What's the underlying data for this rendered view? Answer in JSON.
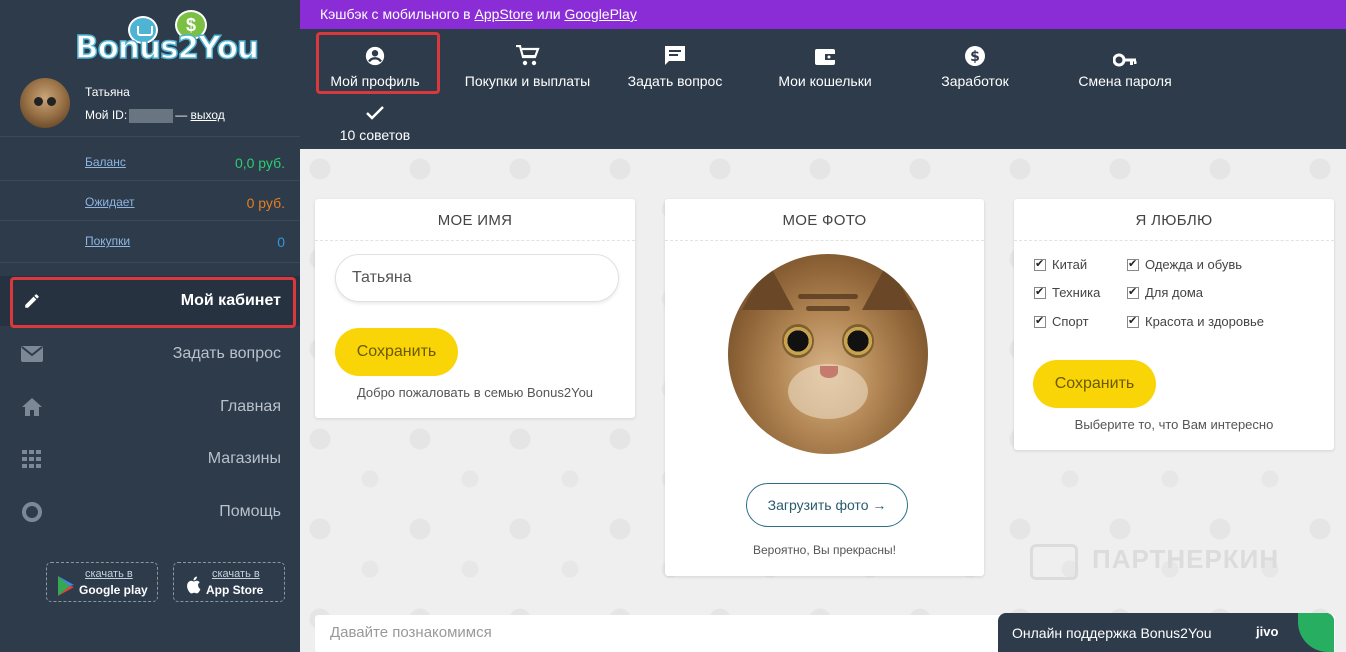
{
  "sidebar": {
    "logo_text": "Bonus2You",
    "logo_dollar": "$",
    "user": {
      "name": "Татьяна",
      "id_label": "Мой ID:",
      "sep": "—",
      "logout": "выход"
    },
    "stats": [
      {
        "label": "Баланс",
        "value": "0,0 руб.",
        "color": "#2ecc71"
      },
      {
        "label": "Ожидает",
        "value": "0 руб.",
        "color": "#e67e22"
      },
      {
        "label": "Покупки",
        "value": "0",
        "color": "#3498db"
      }
    ],
    "nav": [
      {
        "label": "Мой кабинет",
        "icon": "pencil-icon"
      },
      {
        "label": "Задать вопрос",
        "icon": "envelope-icon"
      },
      {
        "label": "Главная",
        "icon": "home-icon"
      },
      {
        "label": "Магазины",
        "icon": "grid-icon"
      },
      {
        "label": "Помощь",
        "icon": "lifebuoy-icon"
      }
    ],
    "stores": [
      {
        "small": "скачать в",
        "big": "Google play",
        "icon": "google-play-icon"
      },
      {
        "small": "скачать в",
        "big": "App Store",
        "icon": "apple-icon"
      }
    ]
  },
  "topbar": {
    "text": "Кэшбэк с мобильного в",
    "link1": "AppStore",
    "or": "или",
    "link2": "GooglePlay"
  },
  "topnav": [
    {
      "label": "Мой профиль",
      "icon": "account-circle-icon"
    },
    {
      "label": "Покупки и выплаты",
      "icon": "cart-icon"
    },
    {
      "label": "Задать вопрос",
      "icon": "message-icon"
    },
    {
      "label": "Мои кошельки",
      "icon": "wallet-icon"
    },
    {
      "label": "Заработок",
      "icon": "dollar-icon"
    },
    {
      "label": "Смена пароля",
      "icon": "key-icon"
    },
    {
      "label": "10 советов",
      "icon": "check-icon"
    }
  ],
  "cards": {
    "name": {
      "title": "МОЕ ИМЯ",
      "value": "Татьяна",
      "button": "Сохранить",
      "note": "Добро пожаловать в семью Bonus2You"
    },
    "photo": {
      "title": "МОЕ ФОТО",
      "button": "Загрузить фото →",
      "note": "Вероятно, Вы прекрасны!"
    },
    "love": {
      "title": "Я ЛЮБЛЮ",
      "options": [
        "Китай",
        "Одежда и обувь",
        "Техника",
        "Для дома",
        "Спорт",
        "Красота и здоровье"
      ],
      "button": "Сохранить",
      "note": "Выберите то, что Вам интересно"
    }
  },
  "bottom": {
    "placeholder": "Давайте познакомимся"
  },
  "watermark": "ПАРТНЕРКИН",
  "chat": {
    "text": "Онлайн поддержка Bonus2You",
    "brand": "jivo"
  },
  "colors": {
    "sidebar": "#2d3b4b",
    "topbar": "#8b2dd6",
    "accent_yellow": "#f9d406",
    "highlight": "#d9393c"
  }
}
